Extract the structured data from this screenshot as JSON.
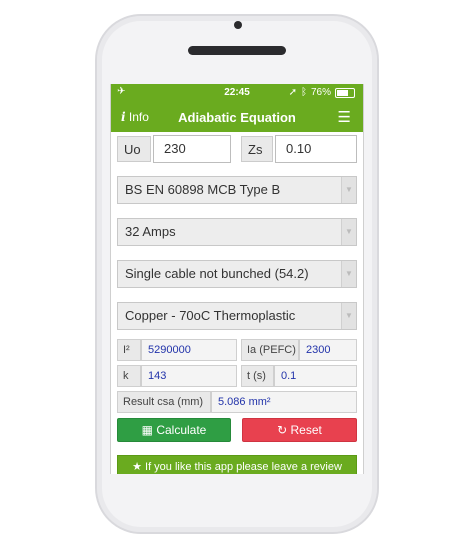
{
  "status_bar": {
    "time": "22:45",
    "battery": "76%"
  },
  "nav": {
    "info_label": "Info",
    "title": "Adiabatic Equation"
  },
  "inputs": {
    "uo_label": "Uo",
    "uo_value": "230",
    "zs_label": "Zs",
    "zs_value": "0.10"
  },
  "selects": [
    "BS EN 60898 MCB Type B",
    "32 Amps",
    "Single cable not bunched (54.2)",
    "Copper - 70oC Thermoplastic"
  ],
  "results": {
    "i2_label": "I²",
    "i2_value": "5290000",
    "ia_label": "Ia (PEFC)",
    "ia_value": "2300",
    "k_label": "k",
    "k_value": "143",
    "t_label": "t (s)",
    "t_value": "0.1",
    "csa_label": "Result csa (mm)",
    "csa_value": "5.086 mm²"
  },
  "buttons": {
    "calculate": "Calculate",
    "reset": "Reset"
  },
  "review": "★ If you like this app please leave a review",
  "colors": {
    "header": "#6aab1f",
    "calculate": "#2f9e44",
    "reset": "#e8414f",
    "result_value": "#2233aa"
  }
}
